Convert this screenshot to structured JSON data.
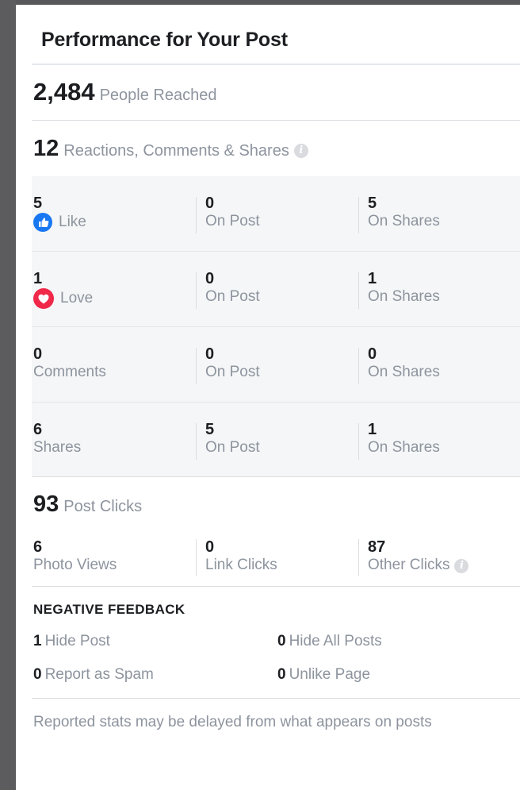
{
  "panel": {
    "title": "Performance for Your Post"
  },
  "reach": {
    "value": "2,484",
    "label": "People Reached"
  },
  "engagement": {
    "value": "12",
    "label": "Reactions, Comments & Shares",
    "info_icon": "info-icon"
  },
  "breakdown": [
    {
      "value": "5",
      "label": "Like",
      "icon": "like-icon",
      "on_post_value": "0",
      "on_post_label": "On Post",
      "on_shares_value": "5",
      "on_shares_label": "On Shares"
    },
    {
      "value": "1",
      "label": "Love",
      "icon": "love-icon",
      "on_post_value": "0",
      "on_post_label": "On Post",
      "on_shares_value": "1",
      "on_shares_label": "On Shares"
    },
    {
      "value": "0",
      "label": "Comments",
      "on_post_value": "0",
      "on_post_label": "On Post",
      "on_shares_value": "0",
      "on_shares_label": "On Shares"
    },
    {
      "value": "6",
      "label": "Shares",
      "on_post_value": "5",
      "on_post_label": "On Post",
      "on_shares_value": "1",
      "on_shares_label": "On Shares"
    }
  ],
  "post_clicks": {
    "value": "93",
    "label": "Post Clicks",
    "items": [
      {
        "value": "6",
        "label": "Photo Views"
      },
      {
        "value": "0",
        "label": "Link Clicks"
      },
      {
        "value": "87",
        "label": "Other Clicks",
        "info_icon": "info-icon"
      }
    ]
  },
  "negative_feedback": {
    "title": "NEGATIVE FEEDBACK",
    "items": [
      {
        "value": "1",
        "label": "Hide Post"
      },
      {
        "value": "0",
        "label": "Hide All Posts"
      },
      {
        "value": "0",
        "label": "Report as Spam"
      },
      {
        "value": "0",
        "label": "Unlike Page"
      }
    ]
  },
  "footer": {
    "note": "Reported stats may be delayed from what appears on posts"
  },
  "colors": {
    "like": "#1877f2",
    "love": "#f02849",
    "muted": "#8d949e",
    "band": "#f5f6f7"
  }
}
